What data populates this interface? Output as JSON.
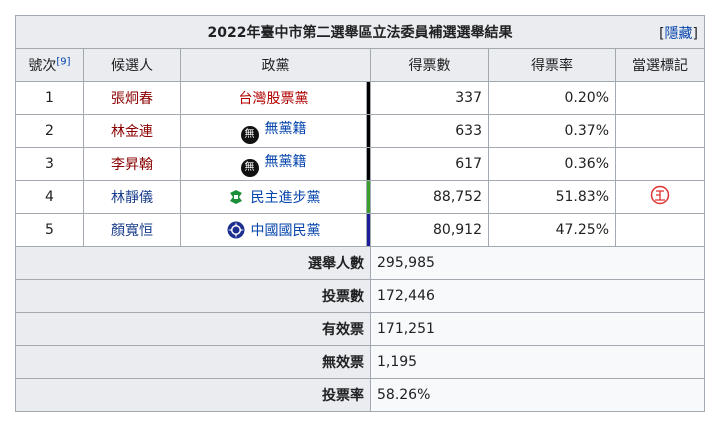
{
  "title": "2022年臺中市第二選舉區立法委員補選選舉結果",
  "title_link_text": "臺中市第二選舉區立法委員",
  "hide_link": "隱藏",
  "headers": {
    "number": "號次",
    "ref": "[9]",
    "candidate": "候選人",
    "party": "政黨",
    "votes": "得票數",
    "rate": "得票率",
    "elected": "當選標記"
  },
  "candidates": [
    {
      "no": "1",
      "name": "張炯春",
      "party": "台灣股票黨",
      "votes": "337",
      "rate": "0.20%",
      "elected": "",
      "party_color": "#000000",
      "name_color": "#8b0000",
      "party_icon": "none"
    },
    {
      "no": "2",
      "name": "林金連",
      "party": "無黨籍",
      "votes": "633",
      "rate": "0.37%",
      "elected": "",
      "party_color": "#000000",
      "name_color": "#8b0000",
      "party_icon": "black-circle-icon"
    },
    {
      "no": "3",
      "name": "李昇翰",
      "party": "無黨籍",
      "votes": "617",
      "rate": "0.36%",
      "elected": "",
      "party_color": "#000000",
      "name_color": "#8b0000",
      "party_icon": "black-circle-icon"
    },
    {
      "no": "4",
      "name": "林靜儀",
      "party": "民主進步黨",
      "votes": "88,752",
      "rate": "51.83%",
      "elected": "㊣",
      "party_color": "#3b9d2b",
      "name_color": "#1a3e8c",
      "party_icon": "dpp-icon"
    },
    {
      "no": "5",
      "name": "顏寬恒",
      "party": "中國國民黨",
      "votes": "80,912",
      "rate": "47.25%",
      "elected": "",
      "party_color": "#1d1d9a",
      "name_color": "#1a3e8c",
      "party_icon": "kmt-icon"
    }
  ],
  "summary": [
    {
      "label": "選舉人數",
      "value": "295,985"
    },
    {
      "label": "投票數",
      "value": "172,446"
    },
    {
      "label": "有效票",
      "value": "171,251"
    },
    {
      "label": "無效票",
      "value": "1,195"
    },
    {
      "label": "投票率",
      "value": "58.26%"
    }
  ]
}
